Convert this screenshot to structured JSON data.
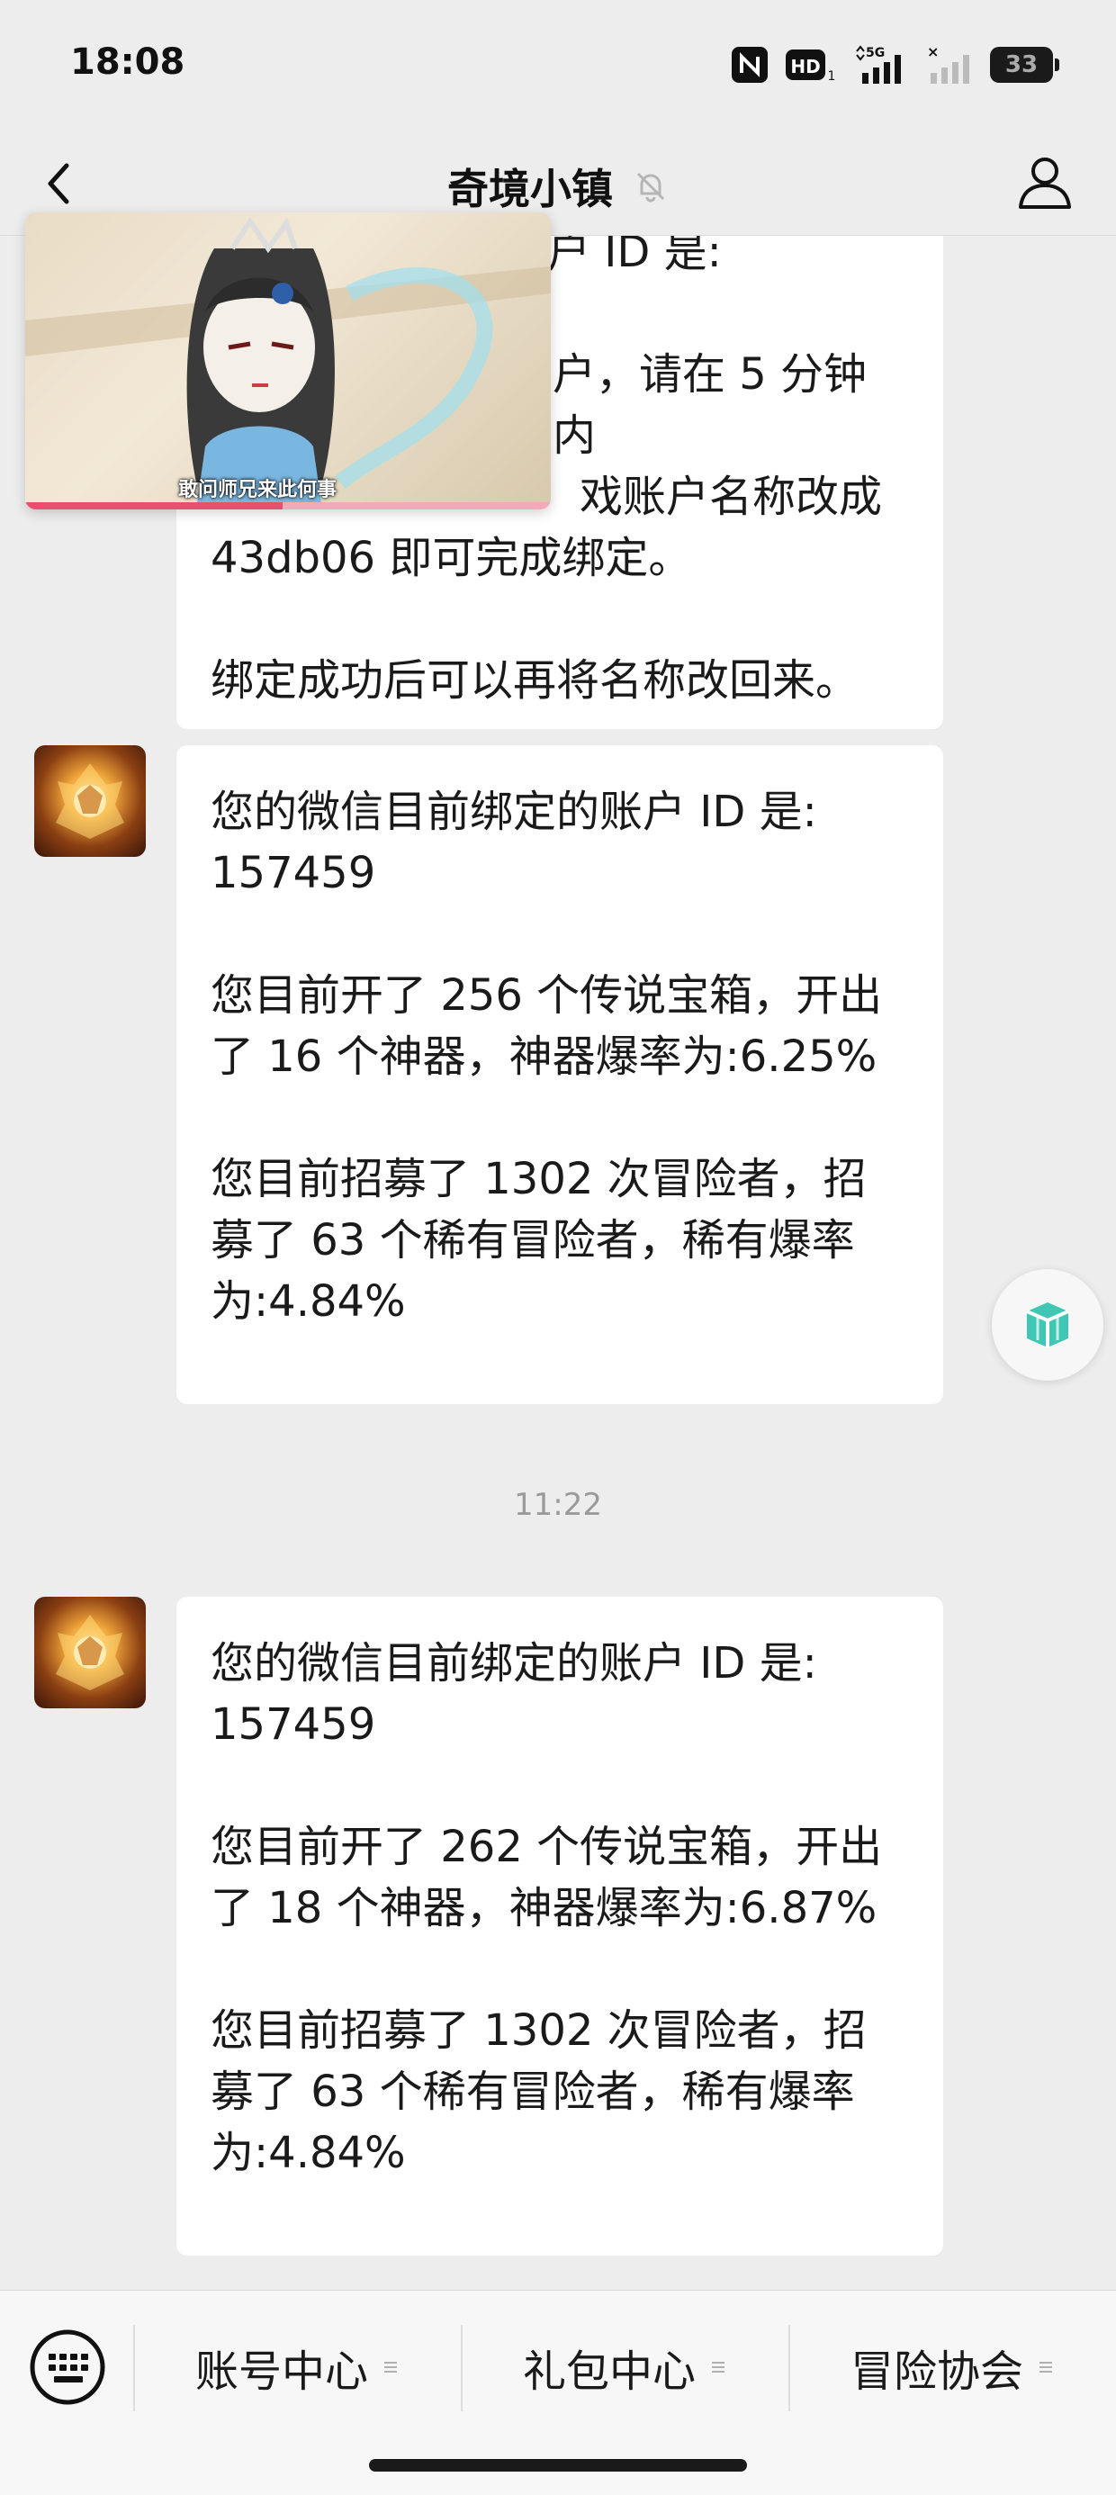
{
  "status_bar": {
    "time": "18:08",
    "battery": "33",
    "icons": [
      "nfc-icon",
      "hd-icon",
      "signal-5g-icon",
      "signal-icon",
      "battery-icon"
    ]
  },
  "nav": {
    "title": "奇境小镇",
    "icons": [
      "back-chevron-icon",
      "mute-bell-icon",
      "profile-icon"
    ]
  },
  "messages": [
    {
      "paragraphs": [
        "您的微信目前绑定的账户 ID 是:",
        "请在 5 分钟内将游戏账户名称改成 43db06 即可完成绑定。",
        "绑定成功后可以再将名称改回来。"
      ],
      "visible_lines": [
        "定的账户 ID 是:",
        "户，请在 5 分钟内",
        "戏账户名称改成",
        "43db06 即可完成绑定。",
        "",
        "绑定成功后可以再将名称改回来。"
      ]
    },
    {
      "paragraphs": [
        "您的微信目前绑定的账户 ID 是:\n157459",
        "您目前开了 256 个传说宝箱，开出了 16 个神器，神器爆率为:6.25%",
        "您目前招募了 1302 次冒险者，招募了 63 个稀有冒险者，稀有爆率为:4.84%"
      ]
    },
    {
      "paragraphs": [
        "您的微信目前绑定的账户 ID 是:\n157459",
        "您目前开了 262 个传说宝箱，开出了 18 个神器，神器爆率为:6.87%",
        "您目前招募了 1302 次冒险者，招募了 63 个稀有冒险者，稀有爆率为:4.84%"
      ]
    }
  ],
  "time_separator": "11:22",
  "floating_video": {
    "caption": "敢问师兄来此何事",
    "progress": 0.49
  },
  "bottom_menu": {
    "keyboard_icon": "keyboard-icon",
    "items": [
      {
        "label": "账号中心"
      },
      {
        "label": "礼包中心"
      },
      {
        "label": "冒险协会"
      }
    ]
  },
  "colors": {
    "background": "#ededed",
    "bubble": "#ffffff",
    "progress": "#e8506f"
  }
}
